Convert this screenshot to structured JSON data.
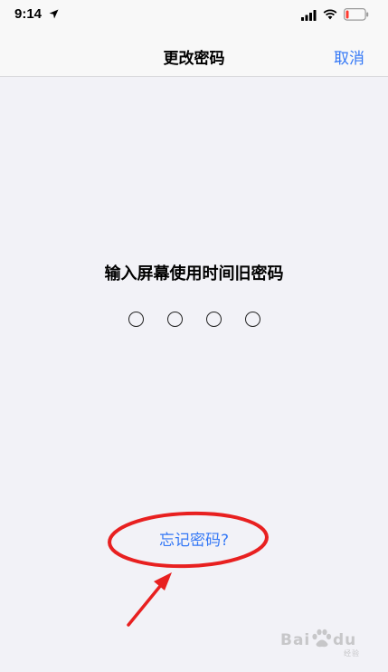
{
  "status_bar": {
    "time": "9:14",
    "location_icon": "location-arrow",
    "signal_icon": "cellular-signal",
    "wifi_icon": "wifi",
    "battery_icon": "battery-low",
    "battery_color": "#ff3b30"
  },
  "nav": {
    "title": "更改密码",
    "cancel_label": "取消"
  },
  "passcode": {
    "prompt": "输入屏幕使用时间旧密码",
    "digit_count": 4,
    "entered_count": 0
  },
  "forgot_label": "忘记密码?",
  "annotation": {
    "color": "#e82020",
    "shapes": [
      "ellipse-highlight",
      "arrow"
    ]
  },
  "watermark": {
    "text": "Baidu",
    "bai": "Bai",
    "du": "du",
    "sub": "经验"
  },
  "colors": {
    "accent": "#3478f6",
    "background": "#f2f2f7"
  }
}
